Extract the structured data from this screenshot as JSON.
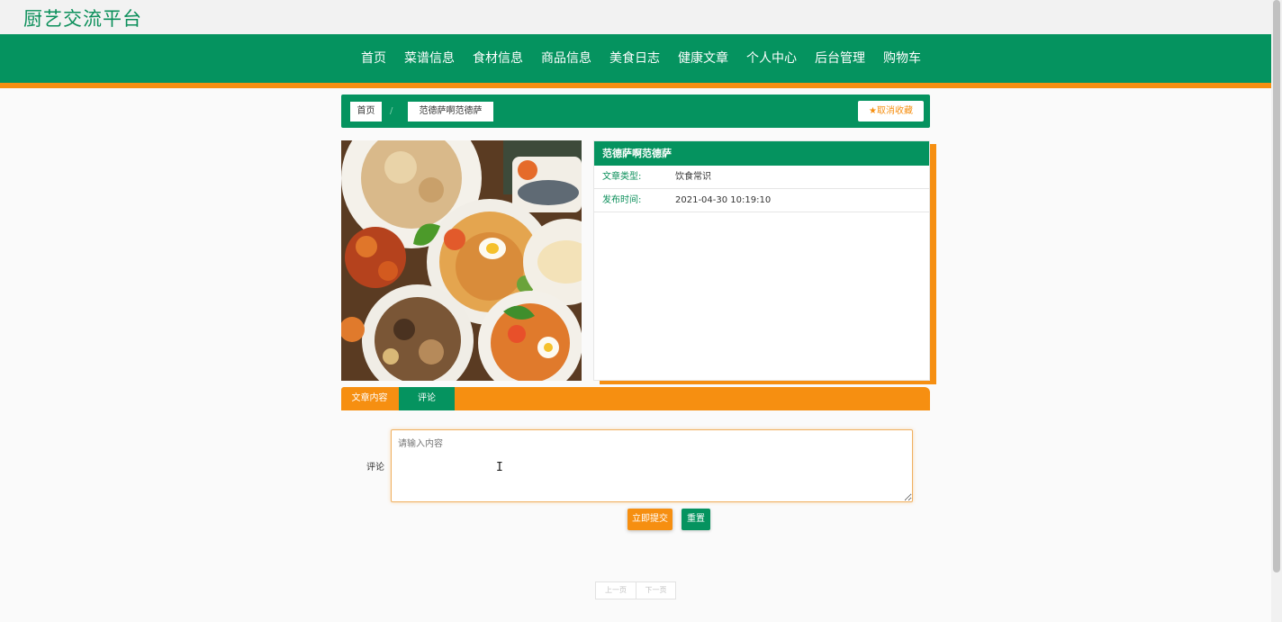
{
  "site": {
    "title": "厨艺交流平台"
  },
  "nav": {
    "items": [
      "首页",
      "菜谱信息",
      "食材信息",
      "商品信息",
      "美食日志",
      "健康文章",
      "个人中心",
      "后台管理",
      "购物车"
    ]
  },
  "breadcrumb": {
    "home": "首页",
    "separator": "/",
    "current": "范德萨啊范德萨",
    "favorite_label": "取消收藏",
    "favorite_icon": "star-icon"
  },
  "article": {
    "title": "范德萨啊范德萨",
    "type_label": "文章类型:",
    "type_value": "饮食常识",
    "time_label": "发布时间:",
    "time_value": "2021-04-30 10:19:10"
  },
  "tabs": {
    "content": "文章内容",
    "comment": "评论"
  },
  "comment_form": {
    "label": "评论",
    "placeholder": "请输入内容",
    "value": "",
    "submit": "立即提交",
    "reset": "重置"
  },
  "pager": {
    "prev": "上一页",
    "next": "下一页"
  },
  "colors": {
    "primary_green": "#05935f",
    "accent_orange": "#f68f11"
  }
}
